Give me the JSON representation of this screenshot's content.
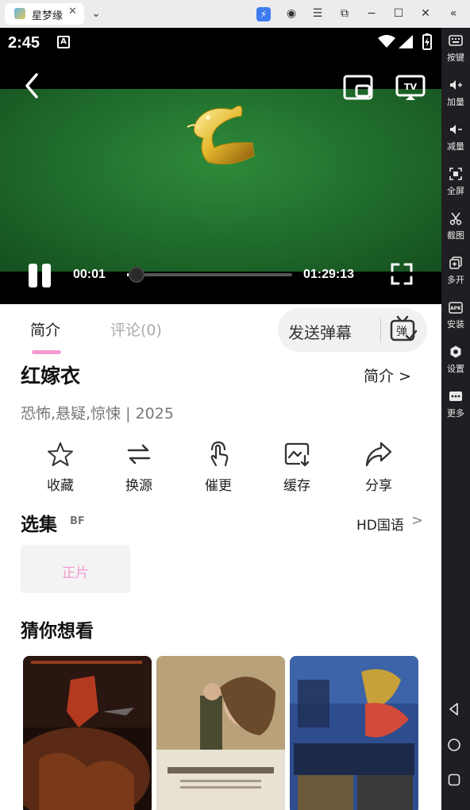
{
  "window": {
    "tab_title": "星梦缘",
    "tab_close_icon": "close-icon",
    "titlebar_icons": [
      "dropdown-chevron-icon",
      "accelerator-icon",
      "account-icon",
      "menu-icon",
      "popout-icon",
      "minimize-icon",
      "maximize-icon",
      "close-icon",
      "collapse-sidebar-icon"
    ]
  },
  "status_bar": {
    "time": "2:45",
    "badge": "A",
    "icons": [
      "wifi-icon",
      "signal-icon",
      "battery-charging-icon"
    ]
  },
  "player": {
    "current_time": "00:01",
    "total_time": "01:29:13",
    "progress": 0.01,
    "icons": [
      "back-icon",
      "picture-in-picture-icon",
      "cast-tv-icon",
      "pause-icon",
      "fullscreen-icon"
    ]
  },
  "tabs": [
    {
      "label": "简介",
      "active": true
    },
    {
      "label": "评论(0)",
      "active": false
    }
  ],
  "danmaku": {
    "label": "发送弹幕",
    "icon": "danmaku-tv-icon"
  },
  "movie": {
    "title": "红嫁衣",
    "intro_link": "简介 >",
    "genre_line": "恐怖,悬疑,惊悚 | 2025"
  },
  "actions": [
    {
      "label": "收藏",
      "icon": "star-icon"
    },
    {
      "label": "换源",
      "icon": "swap-source-icon"
    },
    {
      "label": "催更",
      "icon": "tap-hand-icon"
    },
    {
      "label": "缓存",
      "icon": "download-cache-icon"
    },
    {
      "label": "分享",
      "icon": "share-arrow-icon"
    }
  ],
  "episodes": {
    "title": "选集",
    "source_tag": "BF",
    "quality": "HD国语",
    "chevron": ">",
    "items": [
      "正片"
    ]
  },
  "recommend": {
    "title": "猜你想看",
    "posters": [
      {
        "theme": "war-epic-poster",
        "colors": [
          "#3b1d12",
          "#b33a20",
          "#1a0d08"
        ]
      },
      {
        "theme": "period-romance-poster",
        "colors": [
          "#c9b48f",
          "#5a5a3a",
          "#e8e1d4"
        ]
      },
      {
        "theme": "retro-action-poster",
        "colors": [
          "#2d4d8f",
          "#c8a03a",
          "#1c2a4a"
        ]
      }
    ]
  },
  "sidebar": [
    {
      "label": "按键",
      "icon": "keyboard-icon"
    },
    {
      "label": "加量",
      "icon": "volume-up-icon"
    },
    {
      "label": "减量",
      "icon": "volume-down-icon"
    },
    {
      "label": "全屏",
      "icon": "fullscreen-icon"
    },
    {
      "label": "截图",
      "icon": "scissors-icon"
    },
    {
      "label": "多开",
      "icon": "multi-instance-icon"
    },
    {
      "label": "安装",
      "icon": "apk-install-icon"
    },
    {
      "label": "设置",
      "icon": "settings-gear-icon"
    },
    {
      "label": "更多",
      "icon": "more-dots-icon"
    }
  ],
  "nav_buttons": [
    "back-triangle-icon",
    "home-circle-icon",
    "recents-square-icon"
  ],
  "colors": {
    "accent_pink": "#f29bd0",
    "video_green": "#1f6b2b",
    "sidebar_bg": "#1f1f23"
  }
}
